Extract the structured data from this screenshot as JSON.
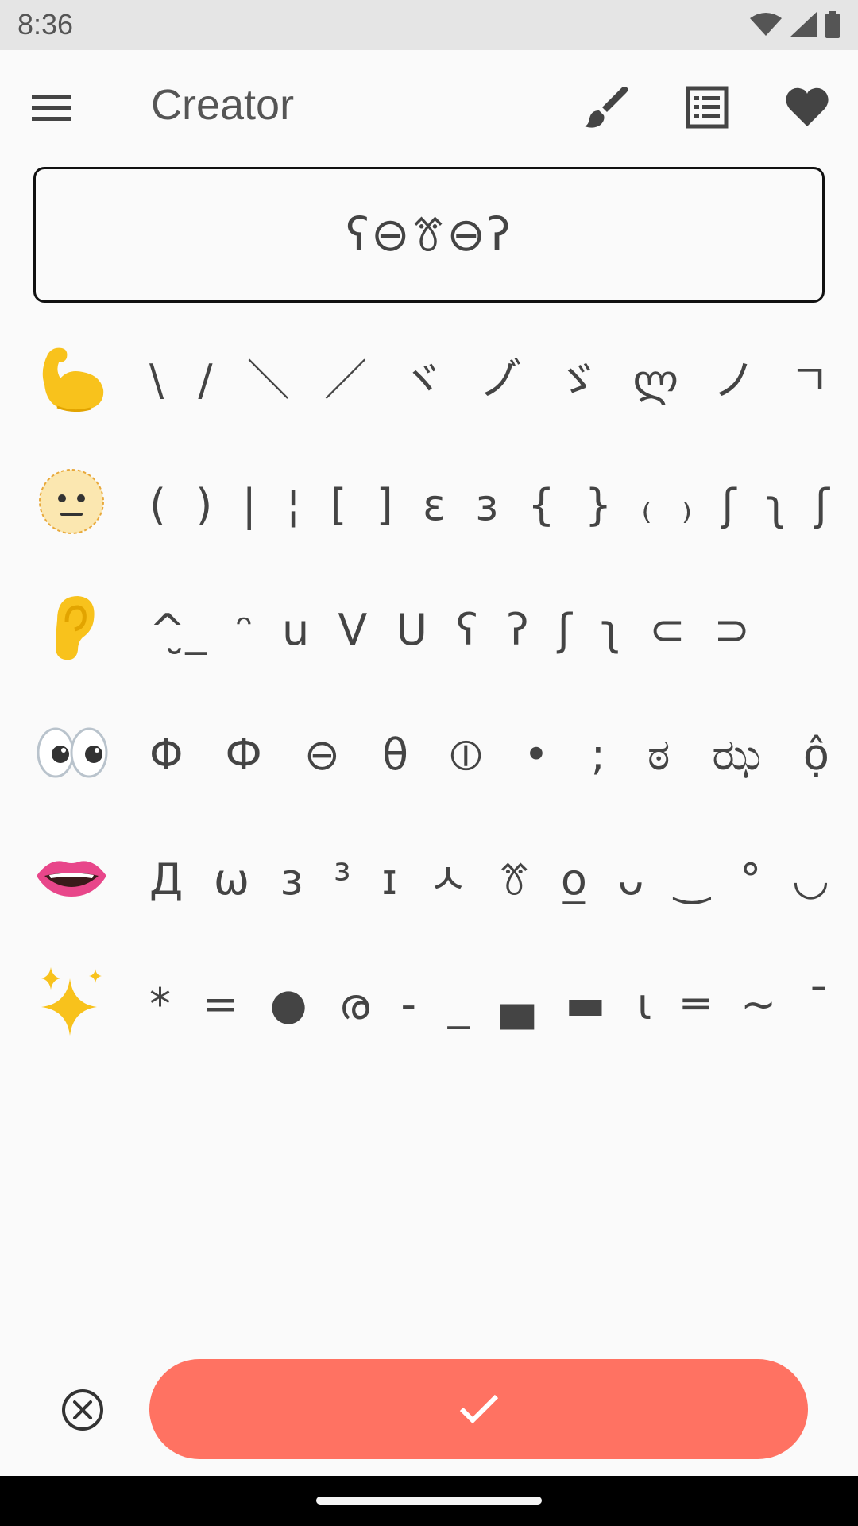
{
  "status_bar": {
    "time": "8:36",
    "icons": [
      "wifi-icon",
      "cell-signal-icon",
      "battery-icon"
    ]
  },
  "app_bar": {
    "title": "Creator",
    "menu_icon": "hamburger-menu-icon",
    "actions": [
      "brush-icon",
      "list-icon",
      "heart-icon"
    ]
  },
  "preview": {
    "text": "ʕ⊖ꔢ⊖ʔ"
  },
  "categories": [
    {
      "icon": "flexed-biceps-icon",
      "chars": [
        "\\",
        "/",
        "＼",
        "／",
        "ヾ",
        "ノ゙",
        "ゞ",
        "ლ",
        "ノ",
        "ㄱ"
      ]
    },
    {
      "icon": "neutral-face-icon",
      "chars": [
        "(",
        ")",
        "|",
        "¦",
        "[",
        "]",
        "ɛ",
        "ɜ",
        "{",
        "}",
        "₍",
        "₎",
        "ʃ",
        "ʅ",
        "ʃ"
      ]
    },
    {
      "icon": "ear-icon",
      "chars": [
        "^̮_",
        "ᵔ",
        "u",
        "V",
        "U",
        "ʕ",
        "ʔ",
        "ʃ",
        "ʅ",
        "⊂",
        "⊃"
      ]
    },
    {
      "icon": "eyes-icon",
      "chars": [
        "Φ",
        "Ф",
        "⊖",
        "θ",
        "⦶",
        "•",
        ";",
        "ಠ",
        "ಝ",
        "ộ"
      ]
    },
    {
      "icon": "mouth-icon",
      "chars": [
        "Д",
        "ω",
        "ɜ",
        "³",
        "ɪ",
        "ㅅ",
        "ꔢ",
        "o̲",
        "ᴗ",
        "‿",
        "°",
        "◡"
      ]
    },
    {
      "icon": "sparkles-icon",
      "chars": [
        "*",
        "=",
        "●",
        "ര",
        "-",
        "_",
        "▄",
        "▬",
        "ι",
        "═",
        "∼",
        "¯"
      ]
    }
  ],
  "bottom": {
    "clear_icon": "clear-circle-icon",
    "confirm_icon": "checkmark-icon",
    "confirm_color": "#ff7262"
  }
}
